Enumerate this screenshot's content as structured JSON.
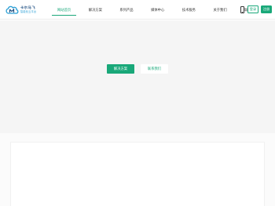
{
  "brand": {
    "name_cn": "卡尔马飞",
    "subtitle": "智能化云平台",
    "colors": {
      "accent": "#19a879",
      "logo_dark": "#1f4f82",
      "logo_light": "#2a9fd6"
    }
  },
  "nav": {
    "items": [
      {
        "label": "网站首页",
        "active": true
      },
      {
        "label": "解决方案",
        "active": false
      },
      {
        "label": "系列产品",
        "active": false
      },
      {
        "label": "媒体中心",
        "active": false
      },
      {
        "label": "技术服务",
        "active": false
      },
      {
        "label": "关于我们",
        "active": false
      },
      {
        "label": "联系我们",
        "active": false
      }
    ]
  },
  "header_actions": {
    "phone_icon": "phone-icon",
    "login_label": "登录",
    "register_label": "注册"
  },
  "hero": {
    "primary_button": "解决方案",
    "secondary_button": "联系我们"
  }
}
